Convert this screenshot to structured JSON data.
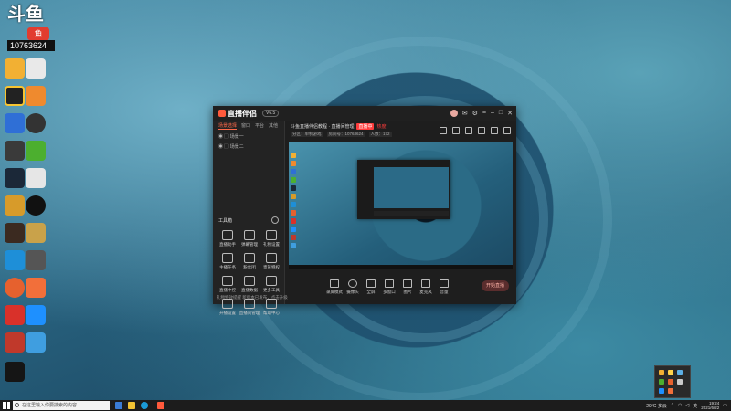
{
  "overlay": {
    "logo": "斗鱼",
    "room_id": "10763624"
  },
  "app": {
    "name": "直播伴侣",
    "version": "V6.5",
    "left_tabs": [
      "场景选择",
      "窗口",
      "平台",
      "其他"
    ],
    "scene_items": [
      "场景一",
      "场景二"
    ],
    "tools_title": "工具箱",
    "tools": [
      "直播助手",
      "弹幕管理",
      "礼物设置",
      "主播任务",
      "粉丝团",
      "贵族特权",
      "直播中控",
      "直播数据",
      "更多工具",
      "开播设置",
      "直播间管理",
      "帮助中心"
    ],
    "notice": "礼物特效提醒   新版本已发布，点击升级",
    "room_title": "斗鱼直播伴侣教程 · 直播间管理",
    "live_badge": "直播中",
    "hot_text": "热度",
    "room_meta": [
      "分区：单机游戏",
      "房间号：10763624",
      "人数：172"
    ],
    "bottom_tools": [
      "录屏模式",
      "摄像头",
      "全屏",
      "多窗口",
      "图片",
      "麦克风",
      "音量"
    ],
    "start_button": "开始直播"
  },
  "taskbar": {
    "search_placeholder": "在这里输入你要搜索的内容",
    "temperature": "29°C 多云",
    "ime": "英",
    "time": "19:24",
    "date": "2021/6/22"
  },
  "colors": {
    "accent": "#ff5a3c",
    "live": "#ff3c3c"
  }
}
